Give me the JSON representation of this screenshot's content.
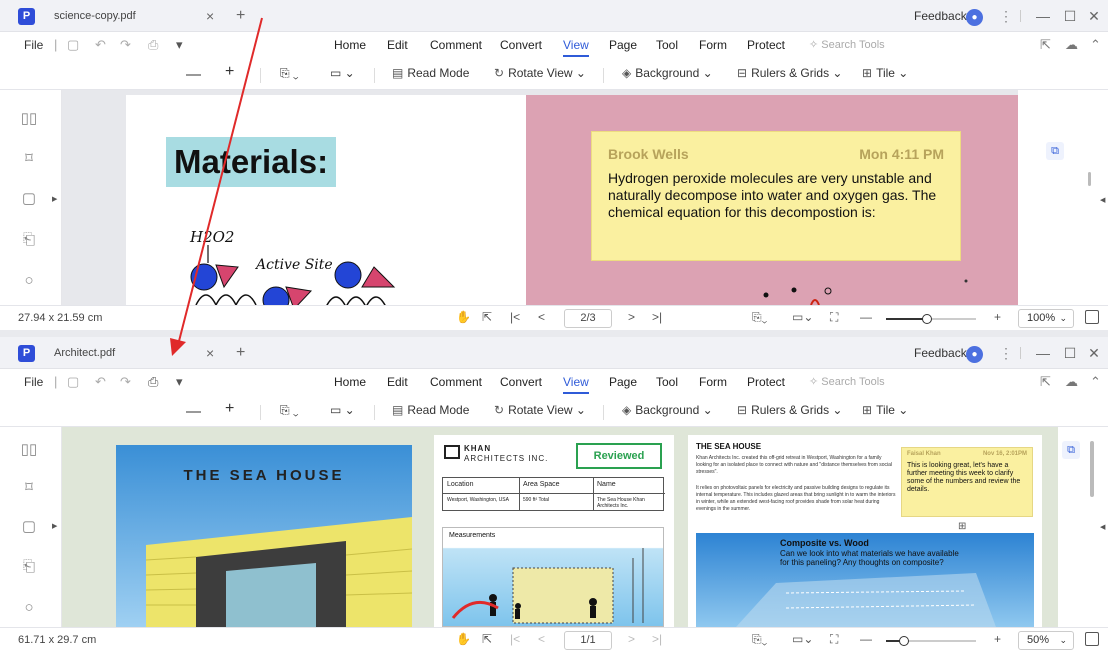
{
  "window1": {
    "tab_title": "science-copy.pdf",
    "tab_close": "×",
    "tab_add": "+",
    "feedback": "Feedback",
    "menu": {
      "file": "File",
      "items": [
        "Home",
        "Edit",
        "Comment",
        "Convert",
        "View",
        "Page",
        "Tool",
        "Form",
        "Protect"
      ],
      "active": "View",
      "search_placeholder": "Search Tools"
    },
    "toolbar": {
      "zoom_out": "—",
      "zoom_in": "+",
      "read_mode": "Read Mode",
      "rotate_view": "Rotate View",
      "background": "Background",
      "rulers_grids": "Rulers & Grids",
      "tile": "Tile"
    },
    "page_left": {
      "title": "Materials:",
      "handwriting_h2o2": "H2O2",
      "handwriting_site": "Active Site"
    },
    "sticky_note": {
      "author": "Brook Wells",
      "time": "Mon 4:11 PM",
      "text": "Hydrogen peroxide molecules are very unstable and naturally decompose into water and oxygen gas. The chemical equation for this decompostion is:"
    },
    "status": {
      "dimensions": "27.94 x 21.59 cm",
      "page": "2/3",
      "zoom": "100%",
      "zoom_fraction": 0.45
    }
  },
  "window2": {
    "tab_title": "Architect.pdf",
    "tab_close": "×",
    "tab_add": "+",
    "feedback": "Feedback",
    "menu": {
      "file": "File",
      "items": [
        "Home",
        "Edit",
        "Comment",
        "Convert",
        "View",
        "Page",
        "Tool",
        "Form",
        "Protect"
      ],
      "active": "View",
      "search_placeholder": "Search Tools"
    },
    "toolbar": {
      "zoom_out": "—",
      "zoom_in": "+",
      "read_mode": "Read Mode",
      "rotate_view": "Rotate View",
      "background": "Background",
      "rulers_grids": "Rulers & Grids",
      "tile": "Tile"
    },
    "page1": {
      "title": "THE SEA HOUSE"
    },
    "page2": {
      "company_line1": "KHAN",
      "company_line2": "ARCHITECTS INC.",
      "stamp": "Reviewed",
      "table_headers": [
        "Location",
        "Area Space",
        "Name"
      ],
      "table_values": [
        "Westport, Washington, USA",
        "590 ft² Total",
        "The Sea House Khan Architects Inc."
      ],
      "measurements": "Measurements"
    },
    "page3": {
      "heading": "THE SEA HOUSE",
      "note_author": "Faisal Khan",
      "note_time": "Nov 16, 2:01PM",
      "note_text": "This is looking great, let's have a further meeting this week to clarify some of the numbers and review the details.",
      "body_text": "Khan Architects Inc. created this off-grid retreat in Westport, Washington for a family looking for an isolated place to connect with nature and \"distance themselves from social stresses\".",
      "body_text2": "It relies on photovoltaic panels for electricity and passive building designs to regulate its internal temperature. This includes glazed areas that bring sunlight in to warm the interiors in winter, while an extended west-facing roof provides shade from solar heat during evenings in the summer.",
      "comp_title": "Composite vs. Wood",
      "comp_text": "Can we look into what materials we have available for this paneling? Any thoughts on composite?"
    },
    "status": {
      "dimensions": "61.71 x 29.7 cm",
      "page": "1/1",
      "zoom": "50%",
      "zoom_fraction": 0.2
    }
  },
  "colors": {
    "accent": "#2f5bd8",
    "arrow": "#e02a2a",
    "note": "#faf0a0",
    "pink_page": "#dca2b3",
    "title_highlight": "#a8dce2",
    "reviewed": "#2aa150"
  }
}
